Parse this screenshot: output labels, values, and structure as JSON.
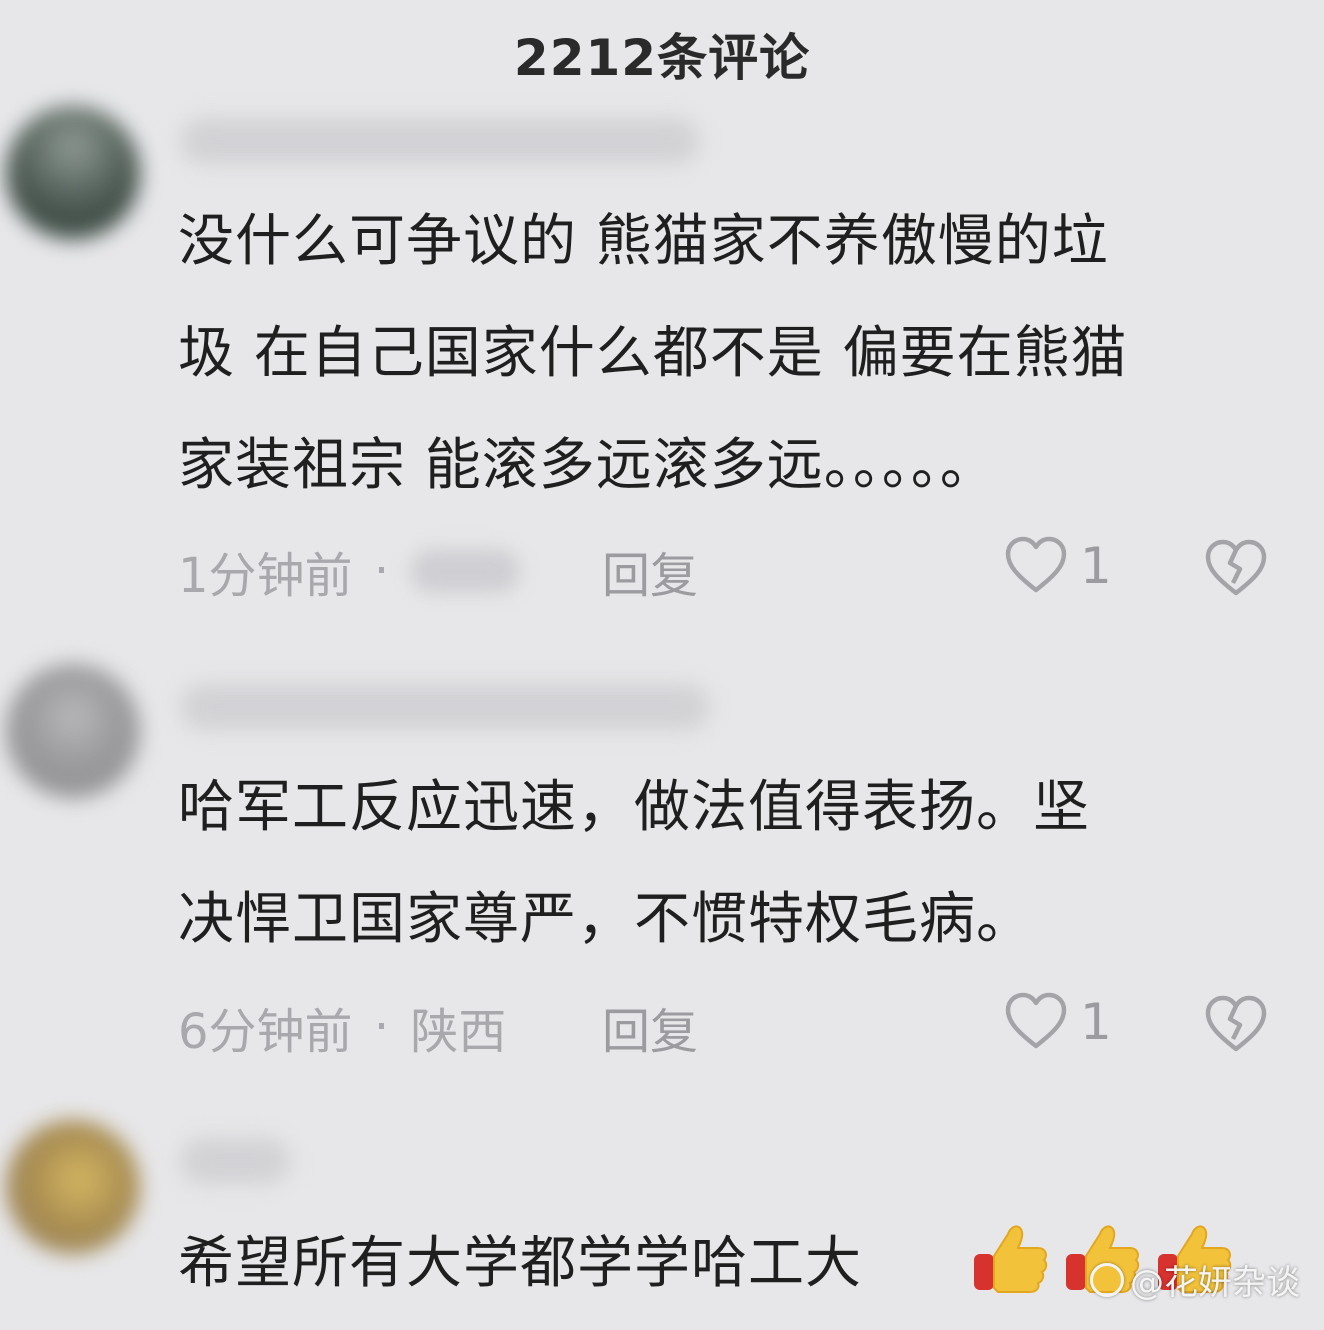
{
  "header": {
    "title": "2212条评论"
  },
  "comments": [
    {
      "text_lines": [
        "没什么可争议的 熊猫家不养傲慢的垃",
        "圾 在自己国家什么都不是 偏要在熊猫",
        "家装祖宗 能滚多远滚多远。。。。。"
      ],
      "time": "1分钟前",
      "separator": "·",
      "location": "",
      "reply_label": "回复",
      "like_count": "1",
      "avatar_color": "#4e5a54"
    },
    {
      "text_lines": [
        "哈军工反应迅速，做法值得表扬。坚",
        "决悍卫国家尊严，不惯特权毛病。"
      ],
      "time": "6分钟前",
      "separator": "·",
      "location": "陕西",
      "reply_label": "回复",
      "like_count": "1",
      "avatar_color": "#9a9a9c"
    },
    {
      "text_lines": [
        "希望所有大学都学学哈工大"
      ],
      "emoji": [
        "thumbs-up",
        "thumbs-up",
        "thumbs-up"
      ],
      "avatar_color": "#a88e55"
    }
  ],
  "watermark": {
    "text": "@花妍杂谈"
  },
  "icons": {
    "like": "heart-outline-icon",
    "dislike": "broken-heart-icon",
    "emoji": "thumbs-up-icon"
  }
}
